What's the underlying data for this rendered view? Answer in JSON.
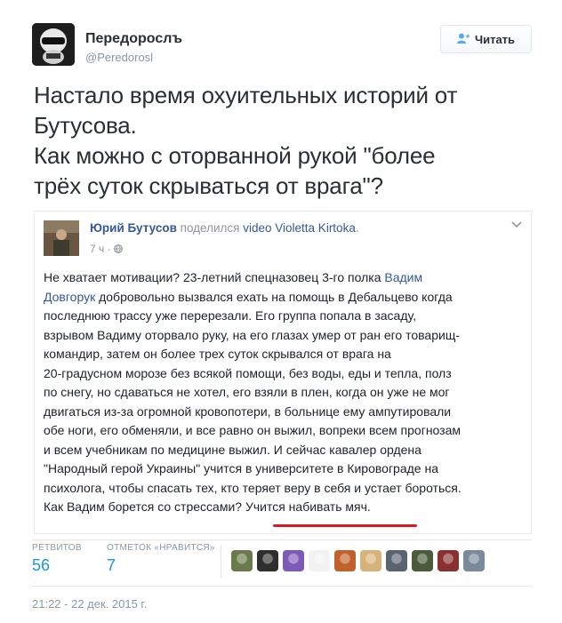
{
  "header": {
    "name": "Передорослъ",
    "handle": "@Peredorosl",
    "follow_label": "Читать",
    "follow_icon": "add-user-icon"
  },
  "tweet": {
    "lines": [
      "Настало время охуительных историй от",
      "Бутусова.",
      "Как можно с оторванной рукой \"более",
      "трёх суток скрываться от врага\"?"
    ]
  },
  "embed": {
    "author": "Юрий Бутусов",
    "shared": "поделился",
    "video_link": "video Violetta Kirtoka",
    "time": "7 ч ·",
    "chevron_icon": "chevron-down-icon",
    "globe_icon": "globe-icon",
    "body": {
      "l1_prefix": "Не хватает мотивации? 23-летний спецназовец 3-го полка ",
      "l1_link": "Вадим",
      "l2_link": "Довгорук",
      "l2_suffix": " добровольно вызвался ехать на помощь в Дебальцево когда",
      "l3": "последнюю трассу уже перерезали. Его группа попала в засаду,",
      "l4": "взрывом Вадиму оторвало руку, на его глазах умер от ран его товарищ-",
      "l5": "командир, затем он более трех суток скрывался от врага на",
      "l6": "20-градусном морозе без всякой помощи, без воды, еды и тепла, полз",
      "l7": "по снегу, но сдаваться не хотел, его взяли в плен, когда он уже не мог",
      "l8": "двигаться из-за огромной кровопотери, в больнице ему ампутировали",
      "l9": "обе ноги, его обменяли, и все равно он выжил, вопреки всем прогнозам",
      "l10": "и всем учебникам по медицине выжил. И сейчас кавалер ордена",
      "l11": "\"Народный герой Украины\" учится в университете в Кировограде на",
      "l12": "психолога, чтобы спасать тех, кто теряет веру в себя и устает бороться.",
      "l13": "Как Вадим борется со стрессами? Учится набивать мяч."
    }
  },
  "stats": {
    "retweets_label": "РЕТВИТОВ",
    "retweets_value": "56",
    "likes_label": "ОТМЕТОК «НРАВИТСЯ»",
    "likes_value": "7",
    "likers": [
      {
        "name": "liker-avatar-1",
        "color": "#6b7a4a"
      },
      {
        "name": "liker-avatar-2",
        "color": "#2f2f2f"
      },
      {
        "name": "liker-avatar-3",
        "color": "#7d5ab8"
      },
      {
        "name": "liker-avatar-4",
        "color": "#f2f2f2"
      },
      {
        "name": "liker-avatar-5",
        "color": "#c2622b"
      },
      {
        "name": "liker-avatar-6",
        "color": "#d9b27a"
      },
      {
        "name": "liker-avatar-7",
        "color": "#5a6470"
      },
      {
        "name": "liker-avatar-8",
        "color": "#4a5a3a"
      },
      {
        "name": "liker-avatar-9",
        "color": "#8a3030"
      },
      {
        "name": "liker-avatar-10",
        "color": "#7a8a9a"
      }
    ]
  },
  "timestamp": "21:22 - 22 дек. 2015 г.",
  "colors": {
    "link_blue": "#1b95e0",
    "fb_link": "#365899",
    "underline_red": "#e0181d"
  }
}
